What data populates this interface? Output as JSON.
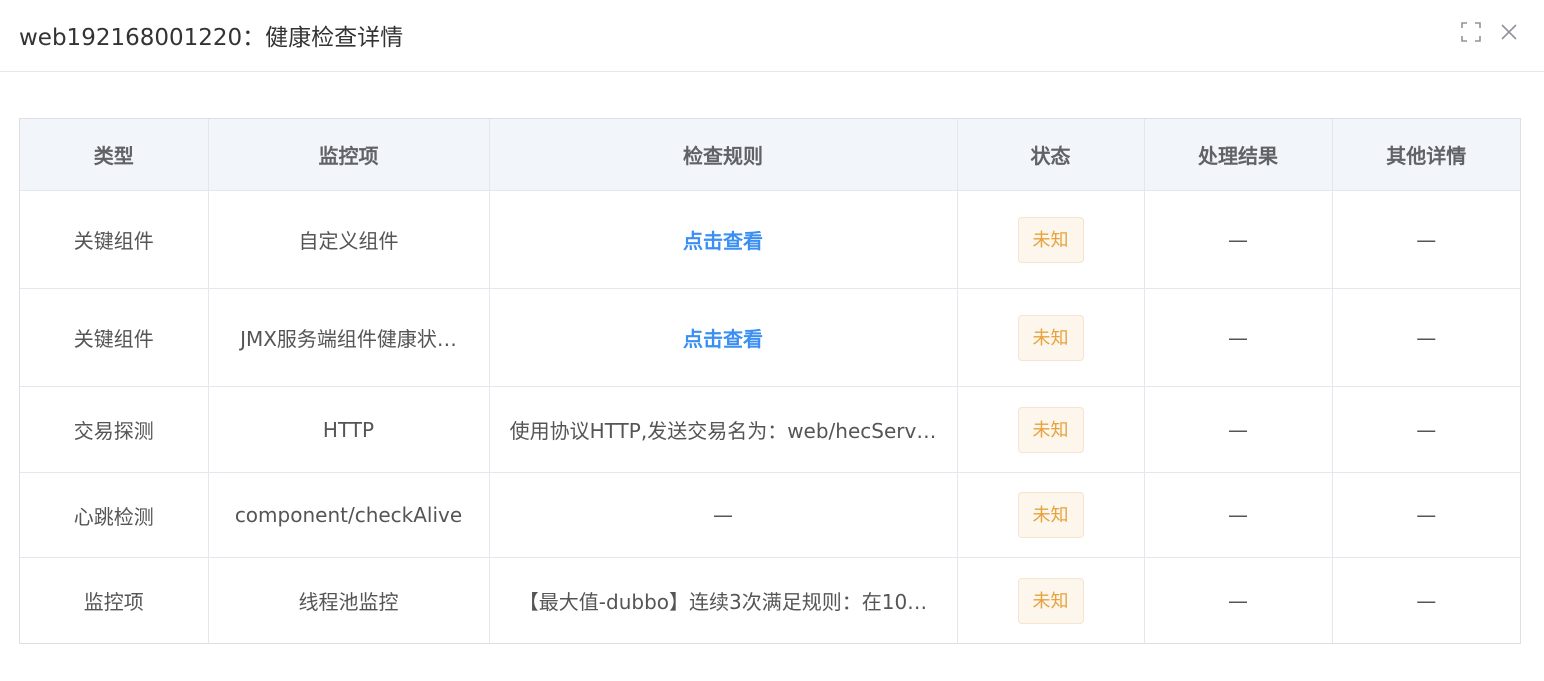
{
  "dialog": {
    "title": "web192168001220：健康检查详情",
    "maximize_icon": "fullscreen-icon",
    "close_icon": "close-icon"
  },
  "table": {
    "columns": [
      "类型",
      "监控项",
      "检查规则",
      "状态",
      "处理结果",
      "其他详情"
    ],
    "rows": [
      {
        "type": "关键组件",
        "item": "自定义组件",
        "rule": "点击查看",
        "rule_is_link": true,
        "status": "未知",
        "result": "—",
        "detail": "—"
      },
      {
        "type": "关键组件",
        "item": "JMX服务端组件健康状…",
        "rule": "点击查看",
        "rule_is_link": true,
        "status": "未知",
        "result": "—",
        "detail": "—"
      },
      {
        "type": "交易探测",
        "item": "HTTP",
        "rule": "使用协议HTTP,发送交易名为：web/hecServ…",
        "rule_is_link": false,
        "status": "未知",
        "result": "—",
        "detail": "—"
      },
      {
        "type": "心跳检测",
        "item": "component/checkAlive",
        "rule": "—",
        "rule_is_link": false,
        "status": "未知",
        "result": "—",
        "detail": "—"
      },
      {
        "type": "监控项",
        "item": "线程池监控",
        "rule": "【最大值-dubbo】连续3次满足规则：在10…",
        "rule_is_link": false,
        "status": "未知",
        "result": "—",
        "detail": "—"
      }
    ]
  },
  "colors": {
    "link": "#3b8ff3",
    "status_text": "#e6a23c",
    "status_bg": "#fdf6ec",
    "header_bg": "#f2f5fa"
  }
}
